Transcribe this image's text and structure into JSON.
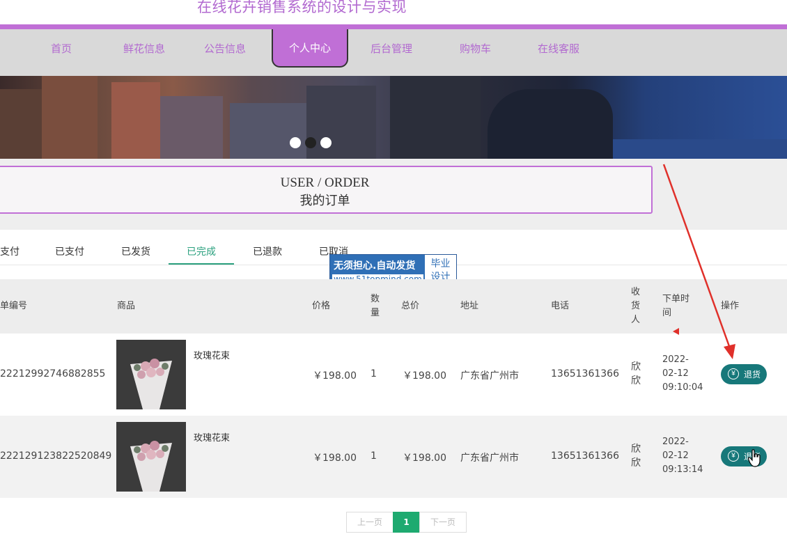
{
  "site": {
    "title": "在线花卉销售系统的设计与实现"
  },
  "nav": {
    "items": [
      {
        "label": "首页"
      },
      {
        "label": "鲜花信息"
      },
      {
        "label": "公告信息"
      },
      {
        "label": "个人中心"
      },
      {
        "label": "后台管理"
      },
      {
        "label": "购物车"
      },
      {
        "label": "在线客服"
      }
    ],
    "active": "个人中心"
  },
  "section": {
    "title_en": "USER / ORDER",
    "title_cn": "我的订单"
  },
  "tabs": {
    "items": [
      {
        "label": "支付"
      },
      {
        "label": "已支付"
      },
      {
        "label": "已发货"
      },
      {
        "label": "已完成"
      },
      {
        "label": "已退款"
      },
      {
        "label": "已取消"
      }
    ],
    "active": "已完成"
  },
  "watermark": {
    "line1": "无须担心.自动发货",
    "url": "www.51topmind.com",
    "badge_top": "毕业",
    "badge_bottom": "设计"
  },
  "table": {
    "headers": {
      "order_no": "单编号",
      "product": "商品",
      "price": "价格",
      "qty_1": "数",
      "qty_2": "量",
      "total": "总价",
      "address": "地址",
      "phone": "电话",
      "receiver_1": "收",
      "receiver_2": "货",
      "receiver_3": "人",
      "time_1": "下单时",
      "time_2": "间",
      "action": "操作"
    },
    "rows": [
      {
        "order_no": "22212992746882855",
        "product": "玫瑰花束",
        "price": "￥198.00",
        "qty": "1",
        "total": "￥198.00",
        "address": "广东省广州市",
        "phone": "13651361366",
        "receiver_1": "欣",
        "receiver_2": "欣",
        "time_1": "2022-",
        "time_2": "02-12",
        "time_3": "09:10:04",
        "action": "退货"
      },
      {
        "order_no": "222129123822520849",
        "product": "玫瑰花束",
        "price": "￥198.00",
        "qty": "1",
        "total": "￥198.00",
        "address": "广东省广州市",
        "phone": "13651361366",
        "receiver_1": "欣",
        "receiver_2": "欣",
        "time_1": "2022-",
        "time_2": "02-12",
        "time_3": "09:13:14",
        "action": "退货"
      }
    ]
  },
  "pagination": {
    "prev": "上一页",
    "current": "1",
    "next": "下一页"
  },
  "colors": {
    "accent": "#c06fd6",
    "tab_active": "#2aa07e",
    "button": "#17787a",
    "annotation_arrow": "#e0302a"
  },
  "icons": {
    "yen": "yen-icon",
    "cursor": "hand-cursor-icon",
    "arrow": "annotation-arrow-icon"
  }
}
